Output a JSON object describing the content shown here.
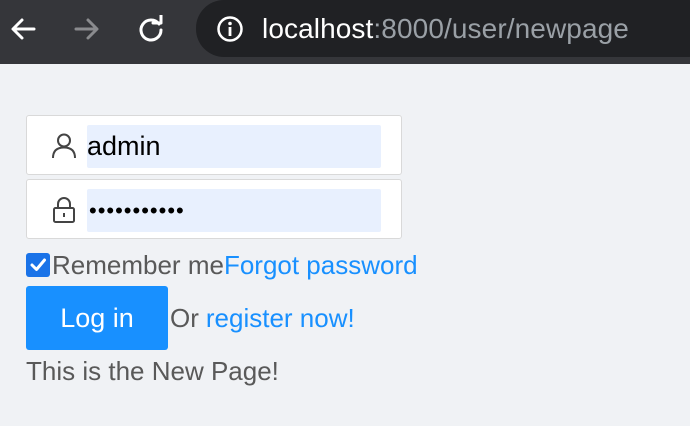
{
  "browser": {
    "url_host": "localhost",
    "url_rest": ":8000/user/newpage"
  },
  "form": {
    "username_value": "admin",
    "password_mask": "•••••••••••",
    "remember_label": "Remember me",
    "remember_checked": true,
    "forgot_label": "Forgot password",
    "login_label": "Log in",
    "or_label": "Or",
    "register_label": "register now!"
  },
  "page": {
    "message": "This is the New Page!"
  },
  "colors": {
    "primary": "#1890ff",
    "autofill_bg": "#e8f0fe",
    "page_bg": "#f0f2f5",
    "browser_bar": "#35363a"
  },
  "icons": {
    "back": "back-arrow-icon",
    "forward": "forward-arrow-icon",
    "reload": "reload-icon",
    "site_info": "info-icon",
    "username": "user-icon",
    "password": "lock-icon",
    "checkbox": "checkmark-icon"
  }
}
